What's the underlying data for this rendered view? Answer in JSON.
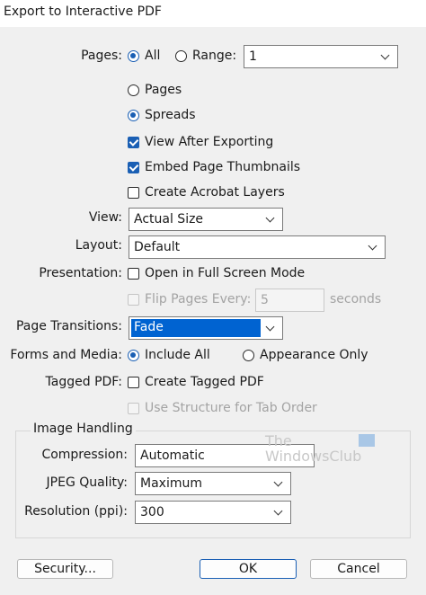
{
  "window": {
    "title": "Export to Interactive PDF"
  },
  "pages": {
    "label": "Pages:",
    "all_label": "All",
    "range_label": "Range:",
    "range_value": "1",
    "pages_option": "Pages",
    "spreads_option": "Spreads"
  },
  "options": {
    "view_after_exporting": "View After Exporting",
    "embed_thumbnails": "Embed Page Thumbnails",
    "create_layers": "Create Acrobat Layers"
  },
  "view": {
    "label": "View:",
    "value": "Actual Size"
  },
  "layout": {
    "label": "Layout:",
    "value": "Default"
  },
  "presentation": {
    "label": "Presentation:",
    "full_screen": "Open in Full Screen Mode",
    "flip_pages": "Flip Pages Every:",
    "flip_value": "5",
    "seconds": "seconds"
  },
  "transitions": {
    "label": "Page Transitions:",
    "value": "Fade"
  },
  "forms": {
    "label": "Forms and Media:",
    "include_all": "Include All",
    "appearance_only": "Appearance Only"
  },
  "tagged": {
    "label": "Tagged PDF:",
    "create_tagged": "Create Tagged PDF",
    "structure_tab": "Use Structure for Tab Order"
  },
  "image_handling": {
    "title": "Image Handling",
    "compression_label": "Compression:",
    "compression_value": "Automatic",
    "jpeg_label": "JPEG Quality:",
    "jpeg_value": "Maximum",
    "resolution_label": "Resolution (ppi):",
    "resolution_value": "300"
  },
  "watermark": {
    "line1": "The",
    "line2": "WindowsClub"
  },
  "buttons": {
    "security": "Security...",
    "ok": "OK",
    "cancel": "Cancel"
  },
  "colors": {
    "accent": "#1a5fb4",
    "selection": "#0063d1",
    "background": "#f0f0f0"
  }
}
